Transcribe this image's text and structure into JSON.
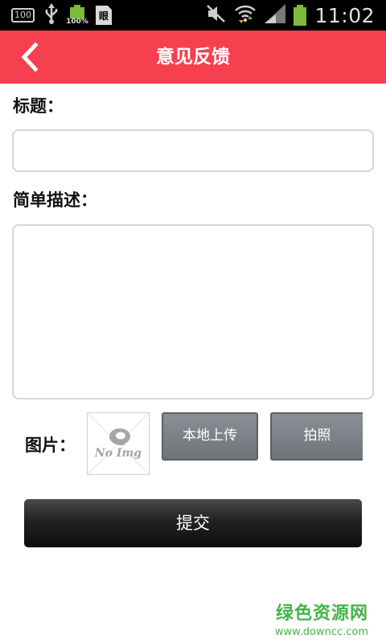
{
  "status_bar": {
    "notif_100": "100",
    "battery_small_pct": "100%",
    "doc_glyph": "眼",
    "time": "11:02",
    "icons": [
      "usb-icon",
      "battery-icon",
      "doc-icon",
      "mute-icon",
      "wifi-icon",
      "signal-icon",
      "battery-icon"
    ]
  },
  "header": {
    "title": "意见反馈",
    "back_icon": "chevron-left-icon",
    "background": "#f6404f"
  },
  "form": {
    "title_label": "标题：",
    "title_value": "",
    "desc_label": "简单描述：",
    "desc_value": "",
    "picture_label": "图片：",
    "no_img_text": "No Img",
    "upload_button": "本地上传",
    "photo_button": "拍照",
    "submit_button": "提交"
  },
  "watermark": {
    "main": "绿色资源网",
    "url": "www.downcc.com",
    "color": "#46b34a"
  }
}
